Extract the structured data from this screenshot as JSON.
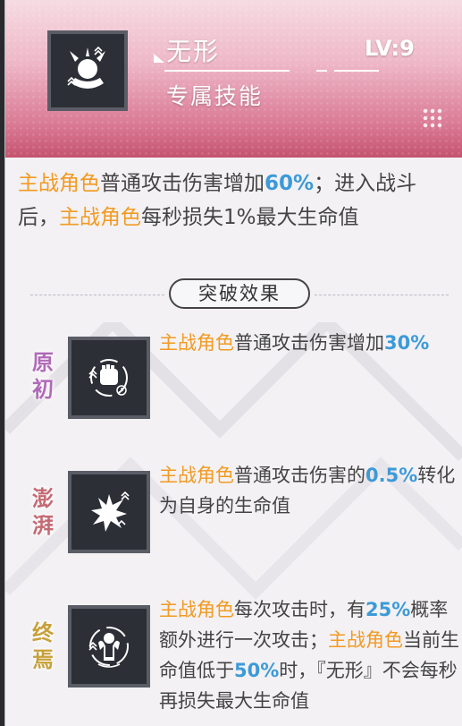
{
  "skill": {
    "name": "无形",
    "level": "LV:9",
    "type": "专属技能",
    "icon": "phantom-figure-icon"
  },
  "description": [
    {
      "t": "主战角色",
      "s": "orange"
    },
    {
      "t": "普通攻击伤害增加",
      "s": ""
    },
    {
      "t": "60%",
      "s": "blue"
    },
    {
      "t": "；进入战斗后，",
      "s": ""
    },
    {
      "t": "主战角色",
      "s": "orange"
    },
    {
      "t": "每秒损失1%最大生命值",
      "s": ""
    }
  ],
  "breakthrough_title": "突破效果",
  "tiers": [
    {
      "label": "原初",
      "icon": "fist-attack-up-icon",
      "text": [
        {
          "t": "主战角色",
          "s": "orange"
        },
        {
          "t": "普通攻击伤害增加",
          "s": ""
        },
        {
          "t": "30%",
          "s": "blue"
        }
      ]
    },
    {
      "label": "澎湃",
      "icon": "impact-burst-icon",
      "text": [
        {
          "t": "主战角色",
          "s": "orange"
        },
        {
          "t": "普通攻击伤害的",
          "s": ""
        },
        {
          "t": "0.5%",
          "s": "blue"
        },
        {
          "t": "转化为自身的生命值",
          "s": ""
        }
      ]
    },
    {
      "label": "终焉",
      "icon": "muscle-figure-icon",
      "text": [
        {
          "t": "主战角色",
          "s": "orange"
        },
        {
          "t": "每次攻击时，有",
          "s": ""
        },
        {
          "t": "25%",
          "s": "blue"
        },
        {
          "t": "概率额外进行一次攻击；",
          "s": ""
        },
        {
          "t": "主战角色",
          "s": "orange"
        },
        {
          "t": "当前生命值低于",
          "s": ""
        },
        {
          "t": "50%",
          "s": "blue"
        },
        {
          "t": "时，『无形』不会每秒再损失最大生命值",
          "s": ""
        }
      ]
    }
  ],
  "colors": {
    "accent_orange": "#f29a22",
    "accent_blue": "#3c9ad8",
    "header_pink": "#d97893"
  }
}
